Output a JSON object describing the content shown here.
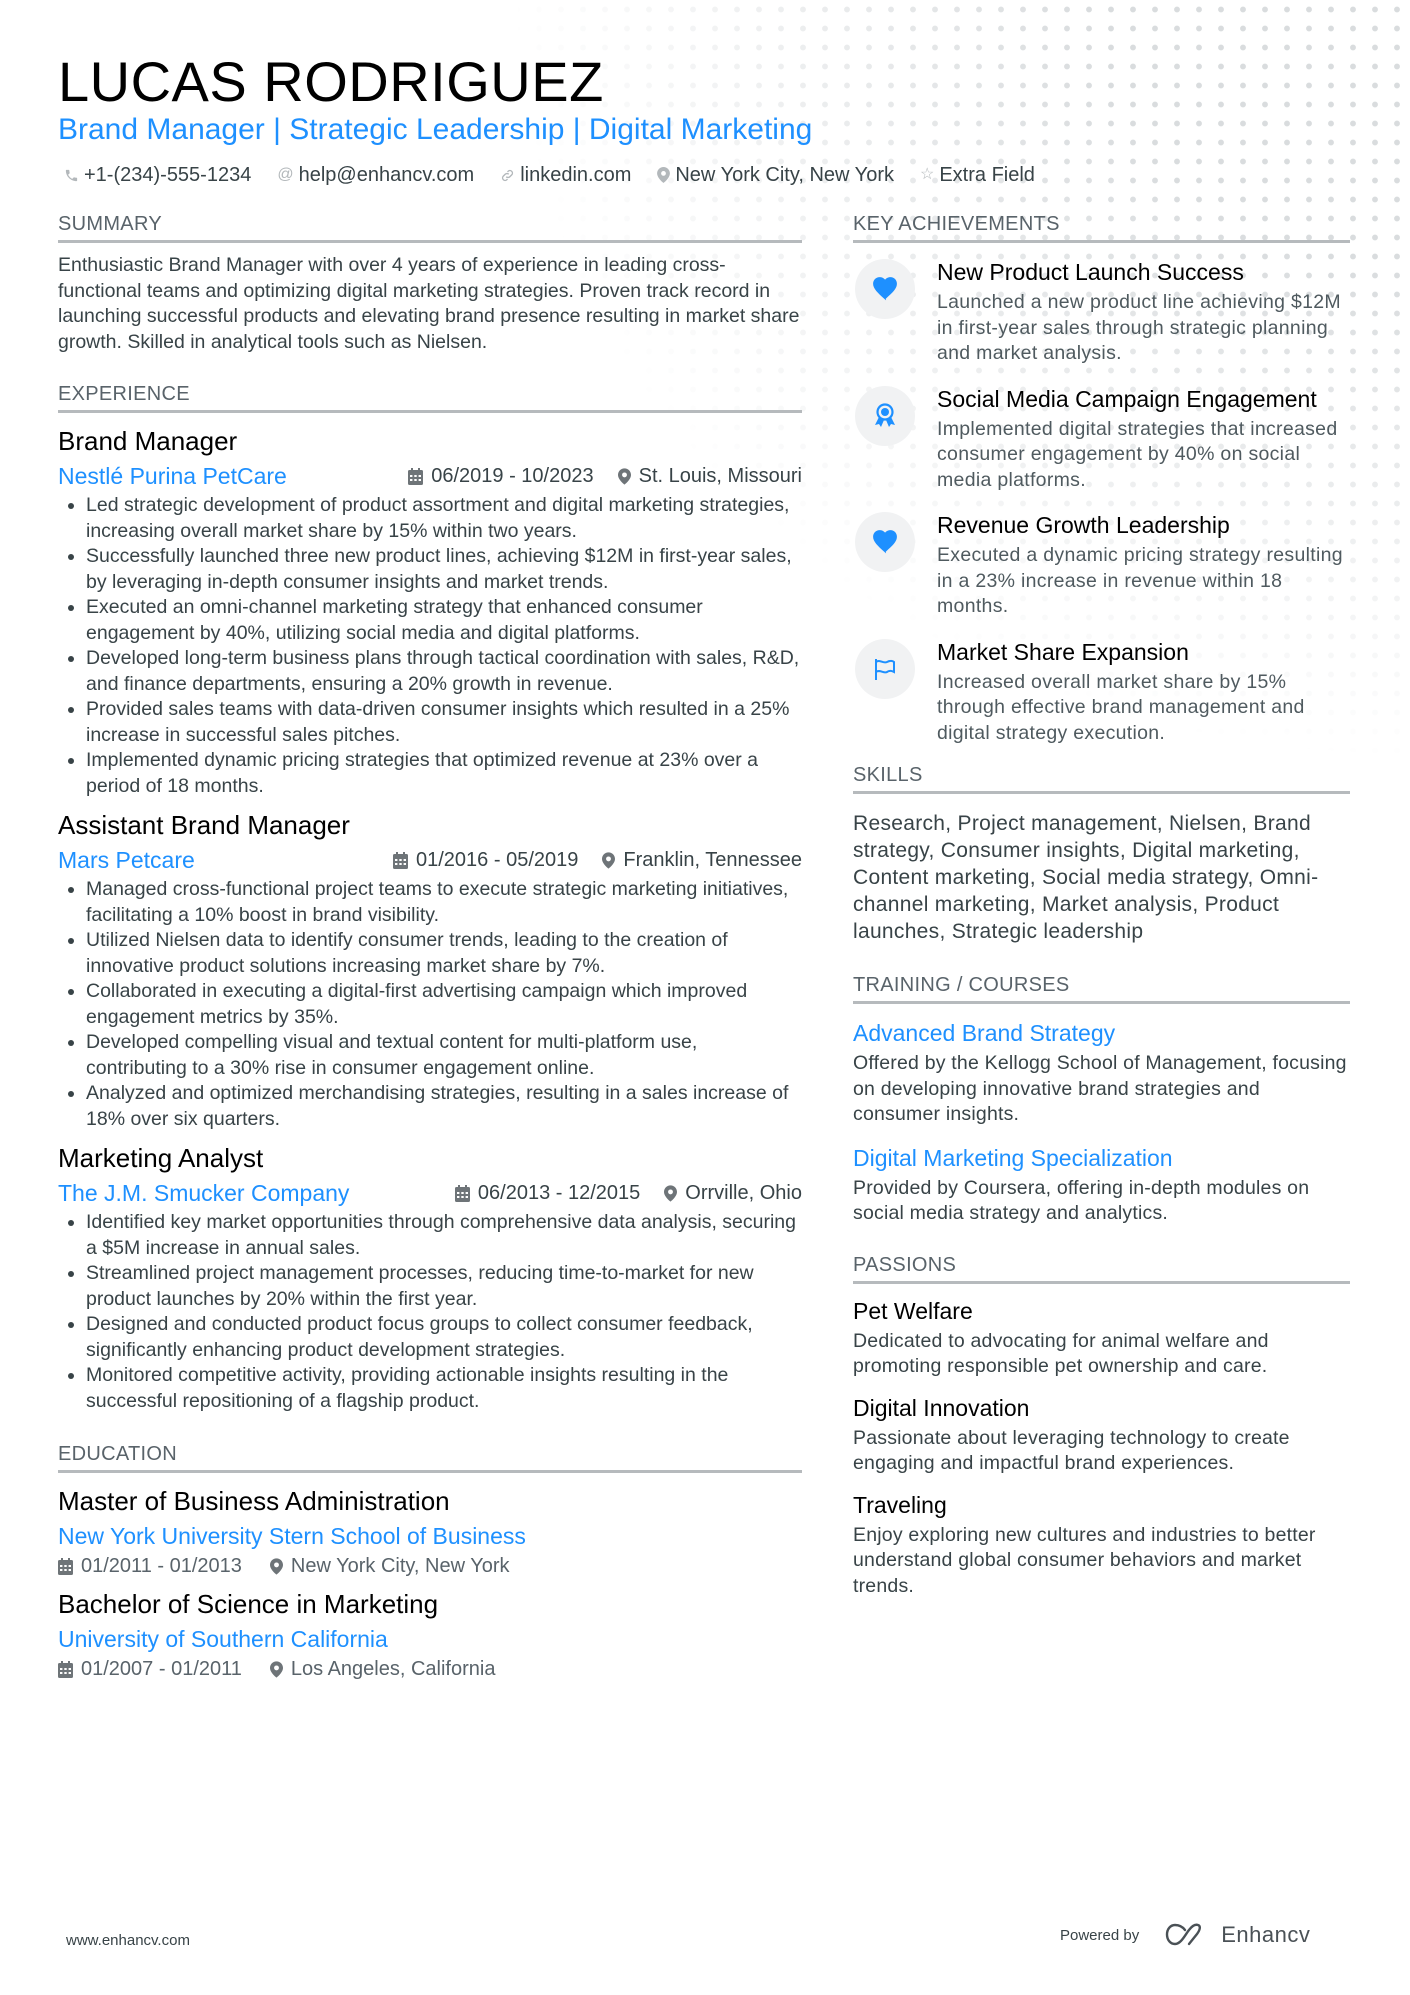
{
  "header": {
    "name": "LUCAS RODRIGUEZ",
    "headline": "Brand Manager | Strategic Leadership | Digital Marketing",
    "contacts": [
      {
        "icon": "phone-icon",
        "text": "+1-(234)-555-1234"
      },
      {
        "icon": "at-icon",
        "text": "help@enhancv.com"
      },
      {
        "icon": "link-icon",
        "text": "linkedin.com"
      },
      {
        "icon": "location-icon",
        "text": "New York City, New York"
      },
      {
        "icon": "star-icon",
        "text": "Extra Field"
      }
    ]
  },
  "summary": {
    "title": "SUMMARY",
    "text": "Enthusiastic Brand Manager with over 4 years of experience in leading cross-functional teams and optimizing digital marketing strategies. Proven track record in launching successful products and elevating brand presence resulting in market share growth. Skilled in analytical tools such as Nielsen."
  },
  "experience": {
    "title": "EXPERIENCE",
    "jobs": [
      {
        "title": "Brand Manager",
        "company": "Nestlé Purina PetCare",
        "dates": "06/2019 - 10/2023",
        "location": "St. Louis, Missouri",
        "bullets": [
          "Led strategic development of product assortment and digital marketing strategies, increasing overall market share by 15% within two years.",
          "Successfully launched three new product lines, achieving $12M in first-year sales, by leveraging in-depth consumer insights and market trends.",
          "Executed an omni-channel marketing strategy that enhanced consumer engagement by 40%, utilizing social media and digital platforms.",
          "Developed long-term business plans through tactical coordination with sales, R&D, and finance departments, ensuring a 20% growth in revenue.",
          "Provided sales teams with data-driven consumer insights which resulted in a 25% increase in successful sales pitches.",
          "Implemented dynamic pricing strategies that optimized revenue at 23% over a period of 18 months."
        ]
      },
      {
        "title": "Assistant Brand Manager",
        "company": "Mars Petcare",
        "dates": "01/2016 - 05/2019",
        "location": "Franklin, Tennessee",
        "bullets": [
          "Managed cross-functional project teams to execute strategic marketing initiatives, facilitating a 10% boost in brand visibility.",
          "Utilized Nielsen data to identify consumer trends, leading to the creation of innovative product solutions increasing market share by 7%.",
          "Collaborated in executing a digital-first advertising campaign which improved engagement metrics by 35%.",
          "Developed compelling visual and textual content for multi-platform use, contributing to a 30% rise in consumer engagement online.",
          "Analyzed and optimized merchandising strategies, resulting in a sales increase of 18% over six quarters."
        ]
      },
      {
        "title": "Marketing Analyst",
        "company": "The J.M. Smucker Company",
        "dates": "06/2013 - 12/2015",
        "location": "Orrville, Ohio",
        "bullets": [
          "Identified key market opportunities through comprehensive data analysis, securing a $5M increase in annual sales.",
          "Streamlined project management processes, reducing time-to-market for new product launches by 20% within the first year.",
          "Designed and conducted product focus groups to collect consumer feedback, significantly enhancing product development strategies.",
          "Monitored competitive activity, providing actionable insights resulting in the successful repositioning of a flagship product."
        ]
      }
    ]
  },
  "education": {
    "title": "EDUCATION",
    "items": [
      {
        "degree": "Master of Business Administration",
        "school": "New York University Stern School of Business",
        "dates": "01/2011 - 01/2013",
        "location": "New York City, New York"
      },
      {
        "degree": "Bachelor of Science in Marketing",
        "school": "University of Southern California",
        "dates": "01/2007 - 01/2011",
        "location": "Los Angeles, California"
      }
    ]
  },
  "achievements": {
    "title": "KEY ACHIEVEMENTS",
    "items": [
      {
        "icon": "heart-icon",
        "title": "New Product Launch Success",
        "desc": "Launched a new product line achieving $12M in first-year sales through strategic planning and market analysis."
      },
      {
        "icon": "award-ribbon-icon",
        "title": "Social Media Campaign Engagement",
        "desc": "Implemented digital strategies that increased consumer engagement by 40% on social media platforms."
      },
      {
        "icon": "heart-icon",
        "title": "Revenue Growth Leadership",
        "desc": "Executed a dynamic pricing strategy resulting in a 23% increase in revenue within 18 months."
      },
      {
        "icon": "flag-icon",
        "title": "Market Share Expansion",
        "desc": "Increased overall market share by 15% through effective brand management and digital strategy execution."
      }
    ]
  },
  "skills": {
    "title": "SKILLS",
    "text": "Research, Project management, Nielsen, Brand strategy, Consumer insights, Digital marketing, Content marketing, Social media strategy, Omni-channel marketing, Market analysis, Product launches, Strategic leadership"
  },
  "training": {
    "title": "TRAINING / COURSES",
    "items": [
      {
        "title": "Advanced Brand Strategy",
        "desc": "Offered by the Kellogg School of Management, focusing on developing innovative brand strategies and consumer insights."
      },
      {
        "title": "Digital Marketing Specialization",
        "desc": "Provided by Coursera, offering in-depth modules on social media strategy and analytics."
      }
    ]
  },
  "passions": {
    "title": "PASSIONS",
    "items": [
      {
        "title": "Pet Welfare",
        "desc": "Dedicated to advocating for animal welfare and promoting responsible pet ownership and care."
      },
      {
        "title": "Digital Innovation",
        "desc": "Passionate about leveraging technology to create engaging and impactful brand experiences."
      },
      {
        "title": "Traveling",
        "desc": "Enjoy exploring new cultures and industries to better understand global consumer behaviors and market trends."
      }
    ]
  },
  "footer": {
    "website": "www.enhancv.com",
    "powered_by": "Powered by",
    "brand": "Enhancv"
  },
  "colors": {
    "accent": "#1e90ff",
    "text": "#384347",
    "heading": "#000000",
    "rule": "#b6babd"
  }
}
